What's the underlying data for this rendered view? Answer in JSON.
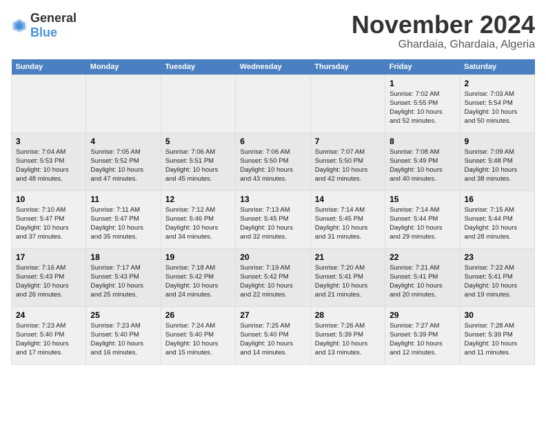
{
  "header": {
    "logo_general": "General",
    "logo_blue": "Blue",
    "month_title": "November 2024",
    "location": "Ghardaia, Ghardaia, Algeria"
  },
  "columns": [
    "Sunday",
    "Monday",
    "Tuesday",
    "Wednesday",
    "Thursday",
    "Friday",
    "Saturday"
  ],
  "weeks": [
    {
      "days": [
        {
          "num": "",
          "info": ""
        },
        {
          "num": "",
          "info": ""
        },
        {
          "num": "",
          "info": ""
        },
        {
          "num": "",
          "info": ""
        },
        {
          "num": "",
          "info": ""
        },
        {
          "num": "1",
          "info": "Sunrise: 7:02 AM\nSunset: 5:55 PM\nDaylight: 10 hours\nand 52 minutes."
        },
        {
          "num": "2",
          "info": "Sunrise: 7:03 AM\nSunset: 5:54 PM\nDaylight: 10 hours\nand 50 minutes."
        }
      ]
    },
    {
      "days": [
        {
          "num": "3",
          "info": "Sunrise: 7:04 AM\nSunset: 5:53 PM\nDaylight: 10 hours\nand 48 minutes."
        },
        {
          "num": "4",
          "info": "Sunrise: 7:05 AM\nSunset: 5:52 PM\nDaylight: 10 hours\nand 47 minutes."
        },
        {
          "num": "5",
          "info": "Sunrise: 7:06 AM\nSunset: 5:51 PM\nDaylight: 10 hours\nand 45 minutes."
        },
        {
          "num": "6",
          "info": "Sunrise: 7:06 AM\nSunset: 5:50 PM\nDaylight: 10 hours\nand 43 minutes."
        },
        {
          "num": "7",
          "info": "Sunrise: 7:07 AM\nSunset: 5:50 PM\nDaylight: 10 hours\nand 42 minutes."
        },
        {
          "num": "8",
          "info": "Sunrise: 7:08 AM\nSunset: 5:49 PM\nDaylight: 10 hours\nand 40 minutes."
        },
        {
          "num": "9",
          "info": "Sunrise: 7:09 AM\nSunset: 5:48 PM\nDaylight: 10 hours\nand 38 minutes."
        }
      ]
    },
    {
      "days": [
        {
          "num": "10",
          "info": "Sunrise: 7:10 AM\nSunset: 5:47 PM\nDaylight: 10 hours\nand 37 minutes."
        },
        {
          "num": "11",
          "info": "Sunrise: 7:11 AM\nSunset: 5:47 PM\nDaylight: 10 hours\nand 35 minutes."
        },
        {
          "num": "12",
          "info": "Sunrise: 7:12 AM\nSunset: 5:46 PM\nDaylight: 10 hours\nand 34 minutes."
        },
        {
          "num": "13",
          "info": "Sunrise: 7:13 AM\nSunset: 5:45 PM\nDaylight: 10 hours\nand 32 minutes."
        },
        {
          "num": "14",
          "info": "Sunrise: 7:14 AM\nSunset: 5:45 PM\nDaylight: 10 hours\nand 31 minutes."
        },
        {
          "num": "15",
          "info": "Sunrise: 7:14 AM\nSunset: 5:44 PM\nDaylight: 10 hours\nand 29 minutes."
        },
        {
          "num": "16",
          "info": "Sunrise: 7:15 AM\nSunset: 5:44 PM\nDaylight: 10 hours\nand 28 minutes."
        }
      ]
    },
    {
      "days": [
        {
          "num": "17",
          "info": "Sunrise: 7:16 AM\nSunset: 5:43 PM\nDaylight: 10 hours\nand 26 minutes."
        },
        {
          "num": "18",
          "info": "Sunrise: 7:17 AM\nSunset: 5:43 PM\nDaylight: 10 hours\nand 25 minutes."
        },
        {
          "num": "19",
          "info": "Sunrise: 7:18 AM\nSunset: 5:42 PM\nDaylight: 10 hours\nand 24 minutes."
        },
        {
          "num": "20",
          "info": "Sunrise: 7:19 AM\nSunset: 5:42 PM\nDaylight: 10 hours\nand 22 minutes."
        },
        {
          "num": "21",
          "info": "Sunrise: 7:20 AM\nSunset: 5:41 PM\nDaylight: 10 hours\nand 21 minutes."
        },
        {
          "num": "22",
          "info": "Sunrise: 7:21 AM\nSunset: 5:41 PM\nDaylight: 10 hours\nand 20 minutes."
        },
        {
          "num": "23",
          "info": "Sunrise: 7:22 AM\nSunset: 5:41 PM\nDaylight: 10 hours\nand 19 minutes."
        }
      ]
    },
    {
      "days": [
        {
          "num": "24",
          "info": "Sunrise: 7:23 AM\nSunset: 5:40 PM\nDaylight: 10 hours\nand 17 minutes."
        },
        {
          "num": "25",
          "info": "Sunrise: 7:23 AM\nSunset: 5:40 PM\nDaylight: 10 hours\nand 16 minutes."
        },
        {
          "num": "26",
          "info": "Sunrise: 7:24 AM\nSunset: 5:40 PM\nDaylight: 10 hours\nand 15 minutes."
        },
        {
          "num": "27",
          "info": "Sunrise: 7:25 AM\nSunset: 5:40 PM\nDaylight: 10 hours\nand 14 minutes."
        },
        {
          "num": "28",
          "info": "Sunrise: 7:26 AM\nSunset: 5:39 PM\nDaylight: 10 hours\nand 13 minutes."
        },
        {
          "num": "29",
          "info": "Sunrise: 7:27 AM\nSunset: 5:39 PM\nDaylight: 10 hours\nand 12 minutes."
        },
        {
          "num": "30",
          "info": "Sunrise: 7:28 AM\nSunset: 5:39 PM\nDaylight: 10 hours\nand 11 minutes."
        }
      ]
    }
  ]
}
